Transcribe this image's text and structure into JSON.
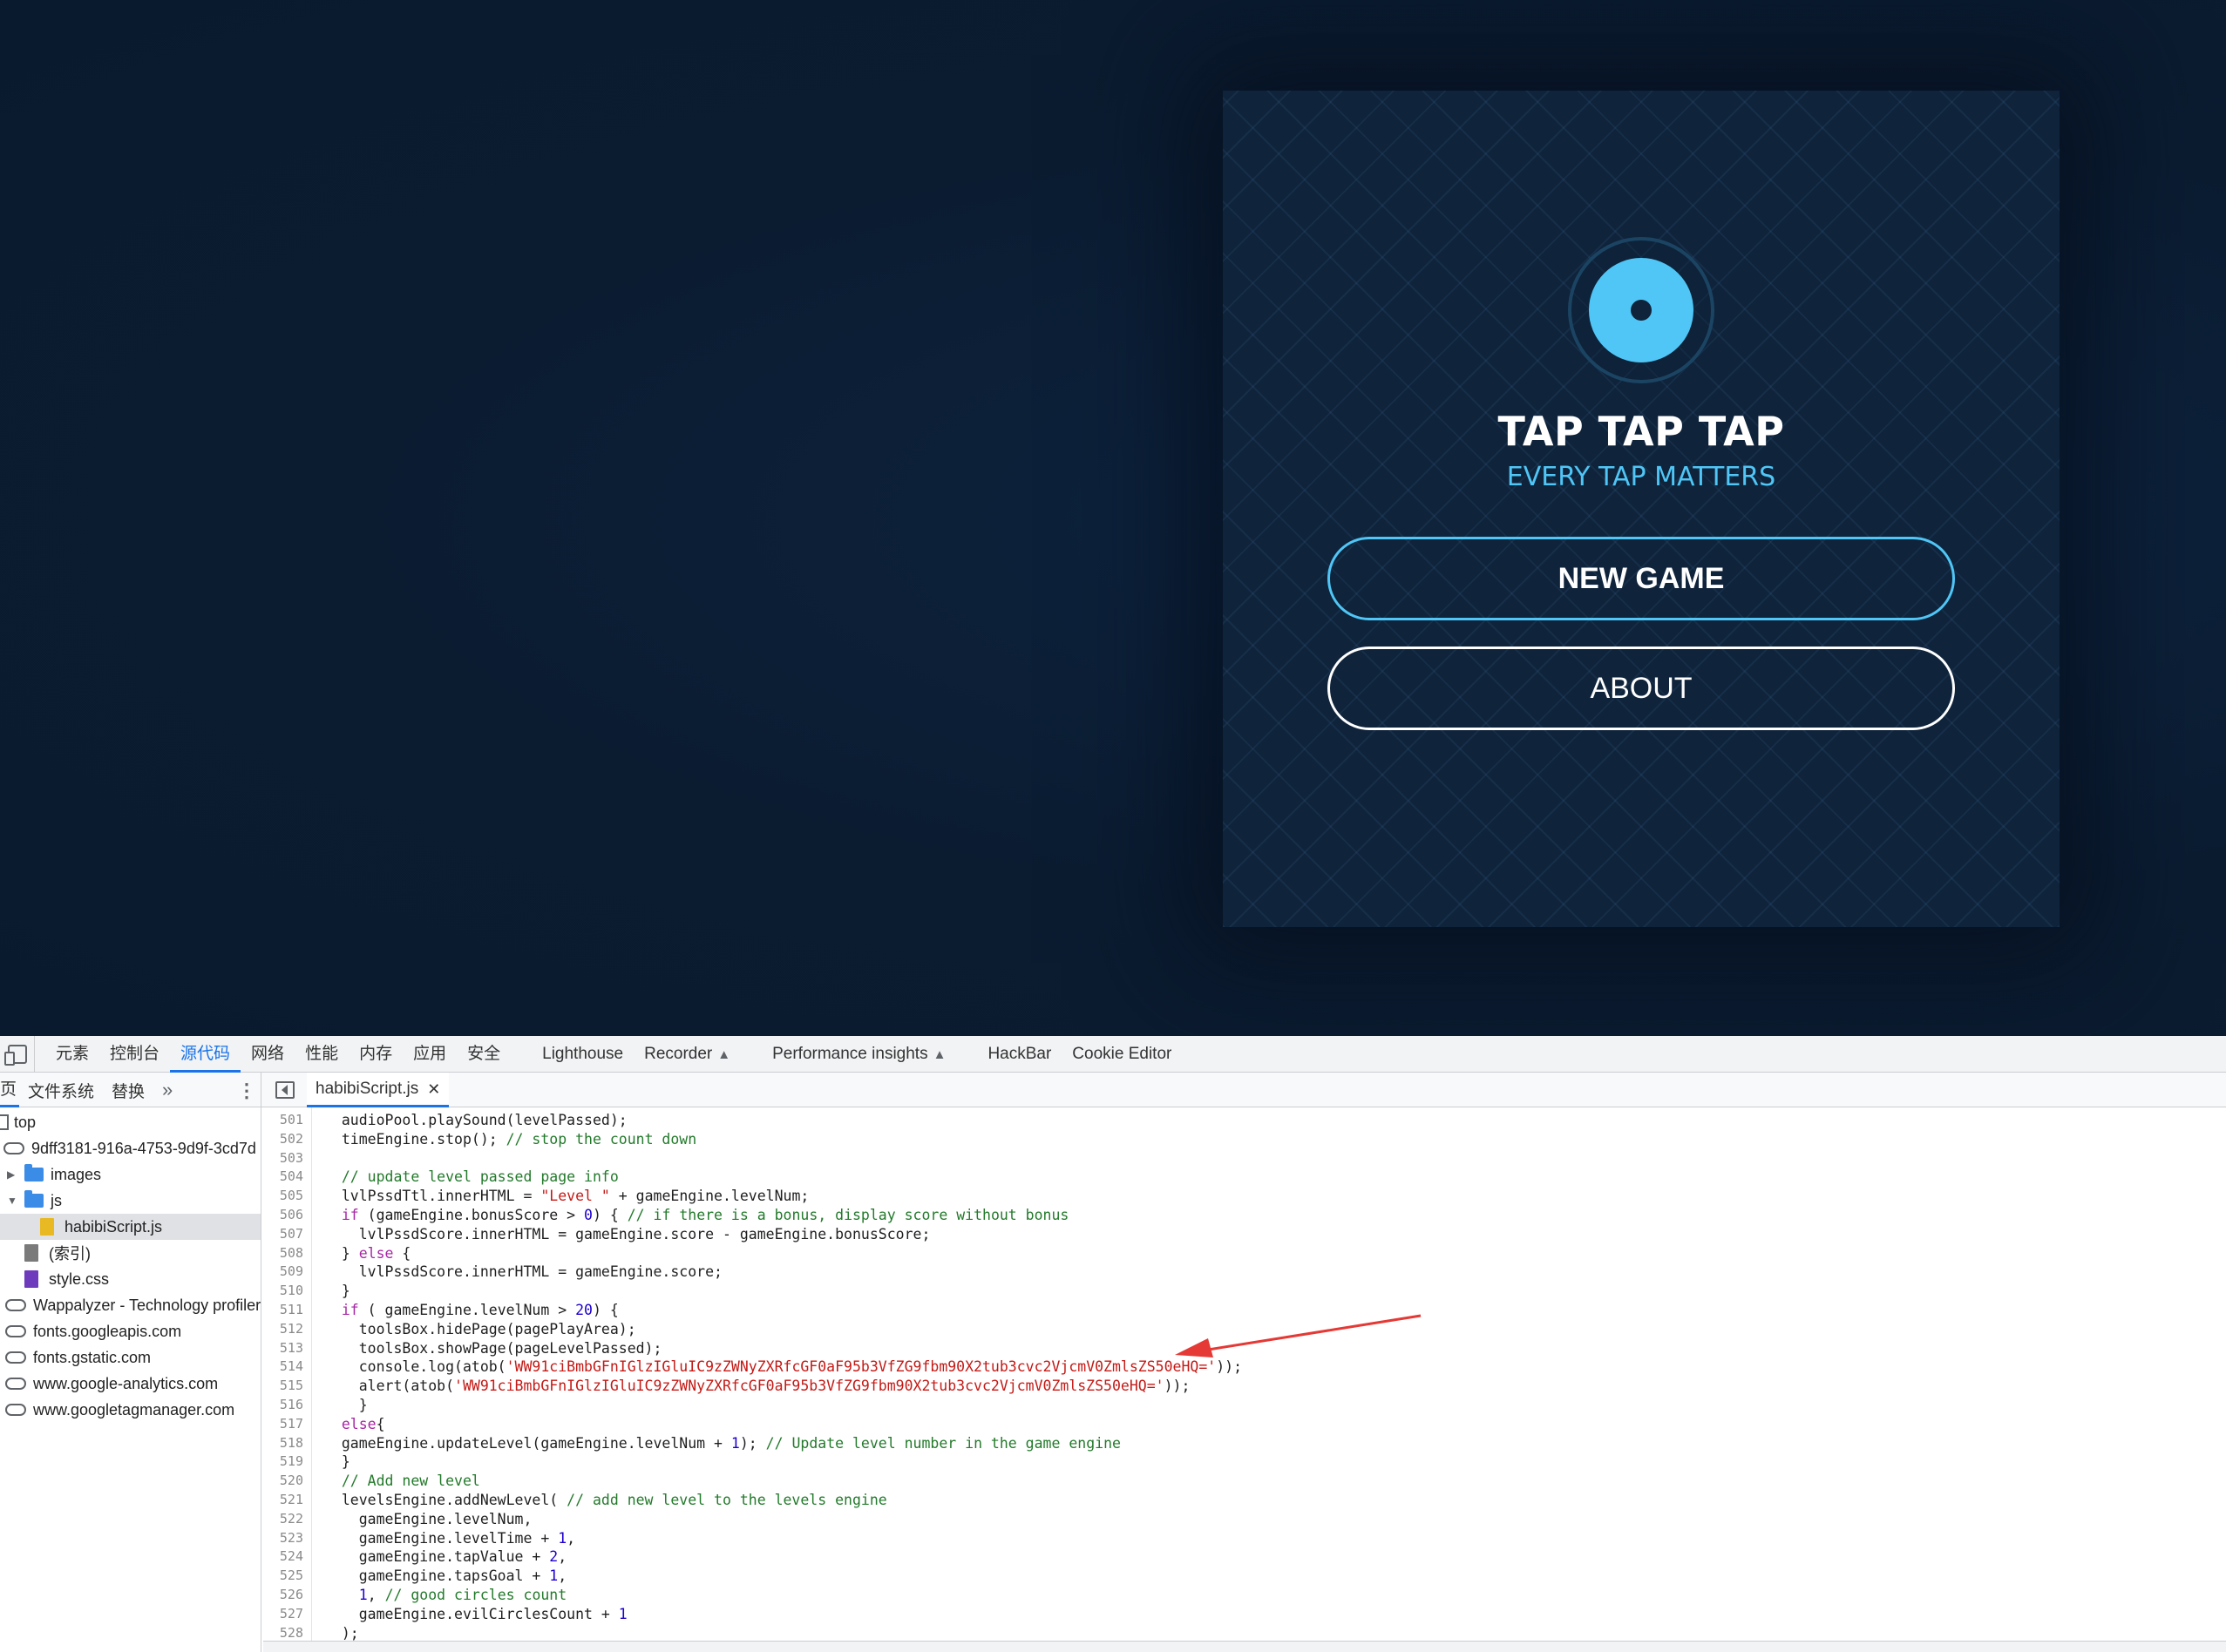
{
  "game": {
    "title": "TAP TAP TAP",
    "subtitle": "EVERY TAP MATTERS",
    "new_game_label": "NEW GAME",
    "about_label": "ABOUT",
    "accent_color": "#4fc6f6"
  },
  "devtools": {
    "tabs": [
      "元素",
      "控制台",
      "源代码",
      "网络",
      "性能",
      "内存",
      "应用",
      "安全",
      "Lighthouse",
      "Recorder",
      "Performance insights",
      "HackBar",
      "Cookie Editor"
    ],
    "active_tab": "源代码",
    "navigator_tabs": [
      "页",
      "文件系统",
      "替换"
    ],
    "open_file": "habibiScript.js",
    "tree": {
      "top": "top",
      "frame": "9dff3181-916a-4753-9d9f-3cd7d",
      "images": "images",
      "js": "js",
      "script": "habibiScript.js",
      "index": "(索引)",
      "style": "style.css",
      "domains": [
        "Wappalyzer - Technology profiler",
        "fonts.googleapis.com",
        "fonts.gstatic.com",
        "www.google-analytics.com",
        "www.googletagmanager.com"
      ]
    }
  },
  "code": {
    "line_numbers": [
      "501",
      "502",
      "503",
      "504",
      "505",
      "506",
      "507",
      "508",
      "509",
      "510",
      "511",
      "512",
      "513",
      "514",
      "515",
      "516",
      "517",
      "518",
      "519",
      "520",
      "521",
      "522",
      "523",
      "524",
      "525",
      "526",
      "527",
      "528"
    ],
    "l501": "audioPool.playSound(levelPassed);",
    "l502a": "timeEngine.stop(); ",
    "l502b": "// stop the count down",
    "l504": "// update level passed page info",
    "l505a": "lvlPssdTtl.innerHTML = ",
    "l505b": "\"Level \"",
    "l505c": " + gameEngine.levelNum;",
    "l506a": "if",
    "l506b": " (gameEngine.bonusScore > ",
    "l506c": "0",
    "l506d": ") { ",
    "l506e": "// if there is a bonus, display score without bonus",
    "l507": "  lvlPssdScore.innerHTML = gameEngine.score - gameEngine.bonusScore;",
    "l508a": "} ",
    "l508b": "else",
    "l508c": " {",
    "l509": "  lvlPssdScore.innerHTML = gameEngine.score;",
    "l510": "}",
    "l511a": "if",
    "l511b": " ( gameEngine.levelNum > ",
    "l511c": "20",
    "l511d": ") {",
    "l512": "  toolsBox.hidePage(pagePlayArea);",
    "l513": "  toolsBox.showPage(pageLevelPassed);",
    "l514a": "  console.log(atob(",
    "l514b": "'WW91ciBmbGFnIGlzIGluIC9zZWNyZXRfcGF0aF95b3VfZG9fbm90X2tub3cvc2VjcmV0ZmlsZS50eHQ='",
    "l514c": "));",
    "l515a": "  alert(atob(",
    "l515b": "'WW91ciBmbGFnIGlzIGluIC9zZWNyZXRfcGF0aF95b3VfZG9fbm90X2tub3cvc2VjcmV0ZmlsZS50eHQ='",
    "l515c": "));",
    "l516": "  }",
    "l517a": "else",
    "l517b": "{",
    "l518a": "gameEngine.updateLevel(gameEngine.levelNum + ",
    "l518b": "1",
    "l518c": "); ",
    "l518d": "// Update level number in the game engine",
    "l519": "}",
    "l520": "// Add new level",
    "l521a": "levelsEngine.addNewLevel( ",
    "l521b": "// add new level to the levels engine",
    "l522": "  gameEngine.levelNum,",
    "l523a": "  gameEngine.levelTime + ",
    "l523b": "1",
    "l523c": ",",
    "l524a": "  gameEngine.tapValue + ",
    "l524b": "2",
    "l524c": ",",
    "l525a": "  gameEngine.tapsGoal + ",
    "l525b": "1",
    "l525c": ",",
    "l526a": "  ",
    "l526b": "1",
    "l526c": ", ",
    "l526d": "// good circles count",
    "l527a": "  gameEngine.evilCirclesCount + ",
    "l527b": "1",
    "l528": ");"
  }
}
